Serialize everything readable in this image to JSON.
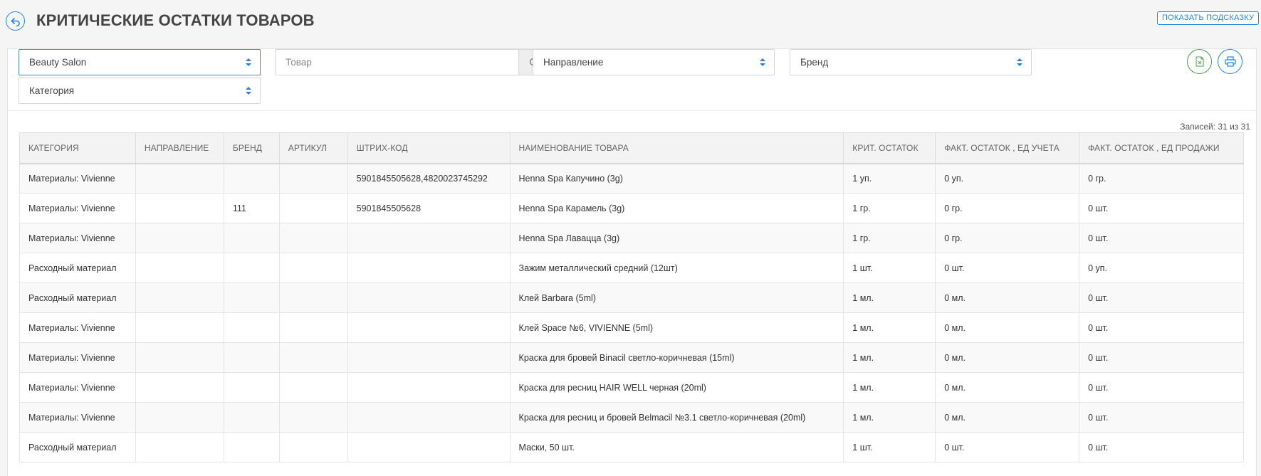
{
  "header": {
    "title": "КРИТИЧЕСКИЕ ОСТАТКИ ТОВАРОВ",
    "hint_button": "ПОКАЗАТЬ ПОДСКАЗКУ"
  },
  "filters": {
    "salon": "Beauty Salon",
    "product_placeholder": "Товар",
    "direction": "Направление",
    "brand": "Бренд",
    "category": "Категория"
  },
  "records": "Записей: 31 из 31",
  "colors": {
    "accent": "#1e88e5",
    "excel": "#43a047"
  },
  "table": {
    "columns": [
      "КАТЕГОРИЯ",
      "НАПРАВЛЕНИЕ",
      "БРЕНД",
      "АРТИКУЛ",
      "ШТРИХ-КОД",
      "НАИМЕНОВАНИЕ ТОВАРА",
      "КРИТ. ОСТАТОК",
      "ФАКТ. ОСТАТОК , ЕД УЧЕТА",
      "ФАКТ. ОСТАТОК , ЕД ПРОДАЖИ"
    ],
    "rows": [
      [
        "Материалы: Vivienne",
        "",
        "",
        "",
        "5901845505628,4820023745292",
        "Henna Spa Капучино (3g)",
        "1 уп.",
        "0 уп.",
        "0 гр."
      ],
      [
        "Материалы: Vivienne",
        "",
        "111",
        "",
        "5901845505628",
        "Henna Spa Карамель (3g)",
        "1 гр.",
        "0 гр.",
        "0 шт."
      ],
      [
        "Материалы: Vivienne",
        "",
        "",
        "",
        "",
        "Henna Spa Лавацца (3g)",
        "1 гр.",
        "0 гр.",
        "0 шт."
      ],
      [
        "Расходный материал",
        "",
        "",
        "",
        "",
        "Зажим металлический средний (12шт)",
        "1 шт.",
        "0 шт.",
        "0 уп."
      ],
      [
        "Расходный материал",
        "",
        "",
        "",
        "",
        "Клей Barbara (5ml)",
        "1 мл.",
        "0 мл.",
        "0 шт."
      ],
      [
        "Материалы: Vivienne",
        "",
        "",
        "",
        "",
        "Клей Space №6, VIVIENNE (5ml)",
        "1 мл.",
        "0 мл.",
        "0 шт."
      ],
      [
        "Материалы: Vivienne",
        "",
        "",
        "",
        "",
        "Краска для бровей Binacil светло-коричневая (15ml)",
        "1 мл.",
        "0 мл.",
        "0 шт."
      ],
      [
        "Материалы: Vivienne",
        "",
        "",
        "",
        "",
        "Краска для ресниц HAIR WELL черная (20ml)",
        "1 мл.",
        "0 мл.",
        "0 шт."
      ],
      [
        "Материалы: Vivienne",
        "",
        "",
        "",
        "",
        "Краска для ресниц и бровей Belmacil №3.1 светло-коричневая (20ml)",
        "1 мл.",
        "0 мл.",
        "0 шт."
      ],
      [
        "Расходный материал",
        "",
        "",
        "",
        "",
        "Маски, 50 шт.",
        "1 шт.",
        "0 шт.",
        "0 шт."
      ]
    ]
  }
}
